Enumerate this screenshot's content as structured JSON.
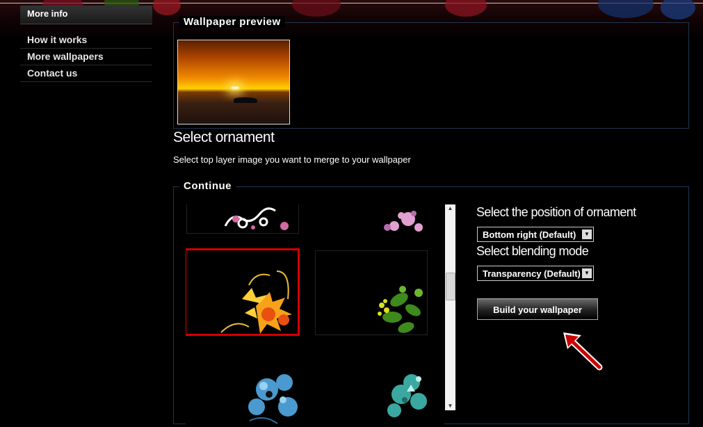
{
  "sidebar": {
    "title": "More info",
    "items": [
      {
        "label": "How it works"
      },
      {
        "label": "More wallpapers"
      },
      {
        "label": "Contact us"
      }
    ]
  },
  "preview": {
    "legend": "Wallpaper preview"
  },
  "select_ornament": {
    "heading": "Select ornament",
    "subtext": "Select top layer image you want to merge to your wallpaper"
  },
  "continue": {
    "legend": "Continue",
    "position_label": "Select the position of ornament",
    "position_value": "Bottom right (Default)",
    "blend_label": "Select blending mode",
    "blend_value": "Transparency (Default)",
    "build_button": "Build your wallpaper",
    "selected_thumbnail_index": 2
  },
  "colors": {
    "background": "#000000",
    "panel_border": "#1f3550",
    "selected_border": "#d40000",
    "annotation_arrow": "#cc0000"
  },
  "icons": [
    "dropdown-arrow-icon",
    "scroll-up-arrow-icon",
    "scroll-down-arrow-icon",
    "annotation-arrow-icon"
  ]
}
